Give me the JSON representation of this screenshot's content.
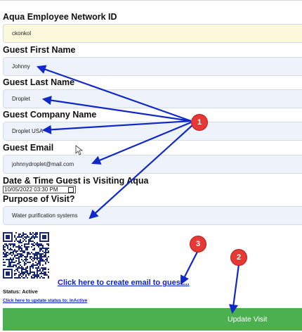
{
  "form": {
    "employee_id_label": "Aqua Employee Network ID",
    "employee_id_value": "ckonkol",
    "first_name_label": "Guest First Name",
    "first_name_value": "Johnny",
    "last_name_label": "Guest Last Name",
    "last_name_value": "Droplet",
    "company_label": "Guest Company Name",
    "company_value": "Droplet USA",
    "email_label": "Guest Email",
    "email_value": "johnnydroplet@mail.com",
    "datetime_label": "Date & Time Guest is Visiting Aqua",
    "datetime_value": "10/05/2022 03:30 PM",
    "purpose_label": "Purpose of Visit?",
    "purpose_value": "Water purification systems"
  },
  "email_link": "Click here to create email to guest...",
  "status_text": "Status: Active",
  "status_link": "Click here to update status to: InActive",
  "update_button": "Update Visit",
  "annotations": [
    "1",
    "2",
    "3"
  ],
  "colors": {
    "update_button": "#4caf50",
    "annotation_badge": "#e53935",
    "annotation_arrow": "#1028c8",
    "link": "#1020d0"
  },
  "icons": [
    "qr-code-icon",
    "calendar-icon",
    "mouse-cursor-icon"
  ]
}
